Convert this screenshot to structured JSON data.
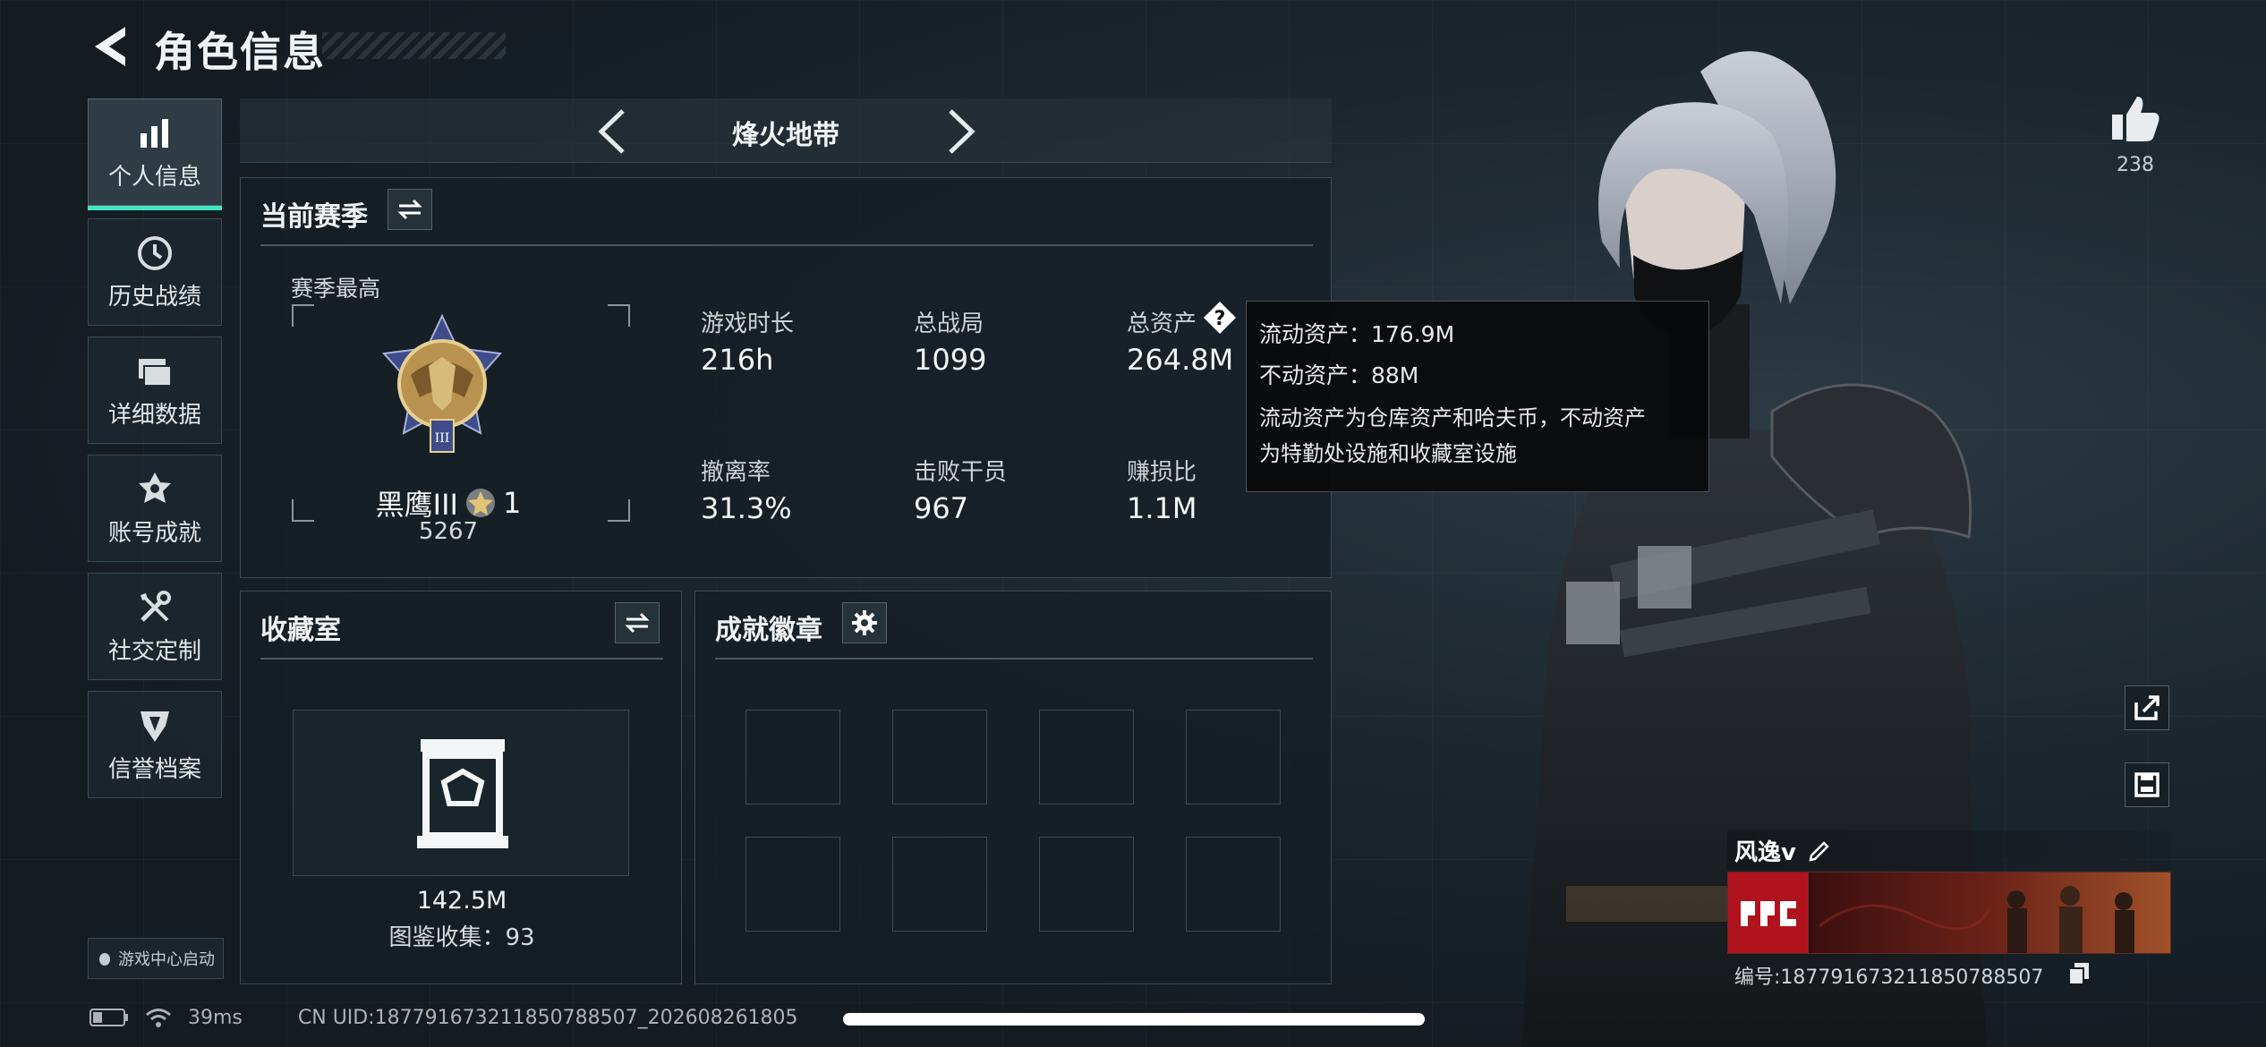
{
  "header": {
    "title": "角色信息"
  },
  "sidebar": {
    "items": [
      {
        "label": "个人信息",
        "icon": "bar-chart-icon",
        "active": true
      },
      {
        "label": "历史战绩",
        "icon": "clock-icon",
        "active": false
      },
      {
        "label": "详细数据",
        "icon": "folder-icon",
        "active": false
      },
      {
        "label": "账号成就",
        "icon": "achievement-icon",
        "active": false
      },
      {
        "label": "社交定制",
        "icon": "tools-icon",
        "active": false
      },
      {
        "label": "信誉档案",
        "icon": "credit-icon",
        "active": false
      }
    ],
    "game_center": "游戏中心启动"
  },
  "mode": {
    "title": "烽火地带"
  },
  "season": {
    "title": "当前赛季",
    "best_label": "赛季最高",
    "rank_name": "黑鹰III",
    "rank_stars": "1",
    "rank_points": "5267",
    "stats": [
      {
        "label": "游戏时长",
        "value": "216h"
      },
      {
        "label": "总战局",
        "value": "1099"
      },
      {
        "label": "总资产",
        "value": "264.8M"
      },
      {
        "label": "撤离率",
        "value": "31.3%"
      },
      {
        "label": "击败干员",
        "value": "967"
      },
      {
        "label": "赚损比",
        "value": "1.1M"
      }
    ]
  },
  "tooltip": {
    "liquid": "流动资产：176.9M",
    "fixed": "不动资产：88M",
    "desc_1": "流动资产为仓库资产和哈夫币，不动资产",
    "desc_2": "为特勤处设施和收藏室设施"
  },
  "collection": {
    "title": "收藏室",
    "value": "142.5M",
    "catalog": "图鉴收集：93"
  },
  "badges": {
    "title": "成就徽章",
    "slots": 8
  },
  "profile": {
    "likes": "238",
    "name": "风逸v",
    "id": "编号:18779167321185078850​7"
  },
  "status": {
    "ping": "39ms",
    "uid": "CN UID:18779167321185078850​7_202608261805"
  },
  "colors": {
    "accent": "#3fe6c1",
    "panel_border": "#3c4a54",
    "tooltip_bg": "#080a0c"
  }
}
